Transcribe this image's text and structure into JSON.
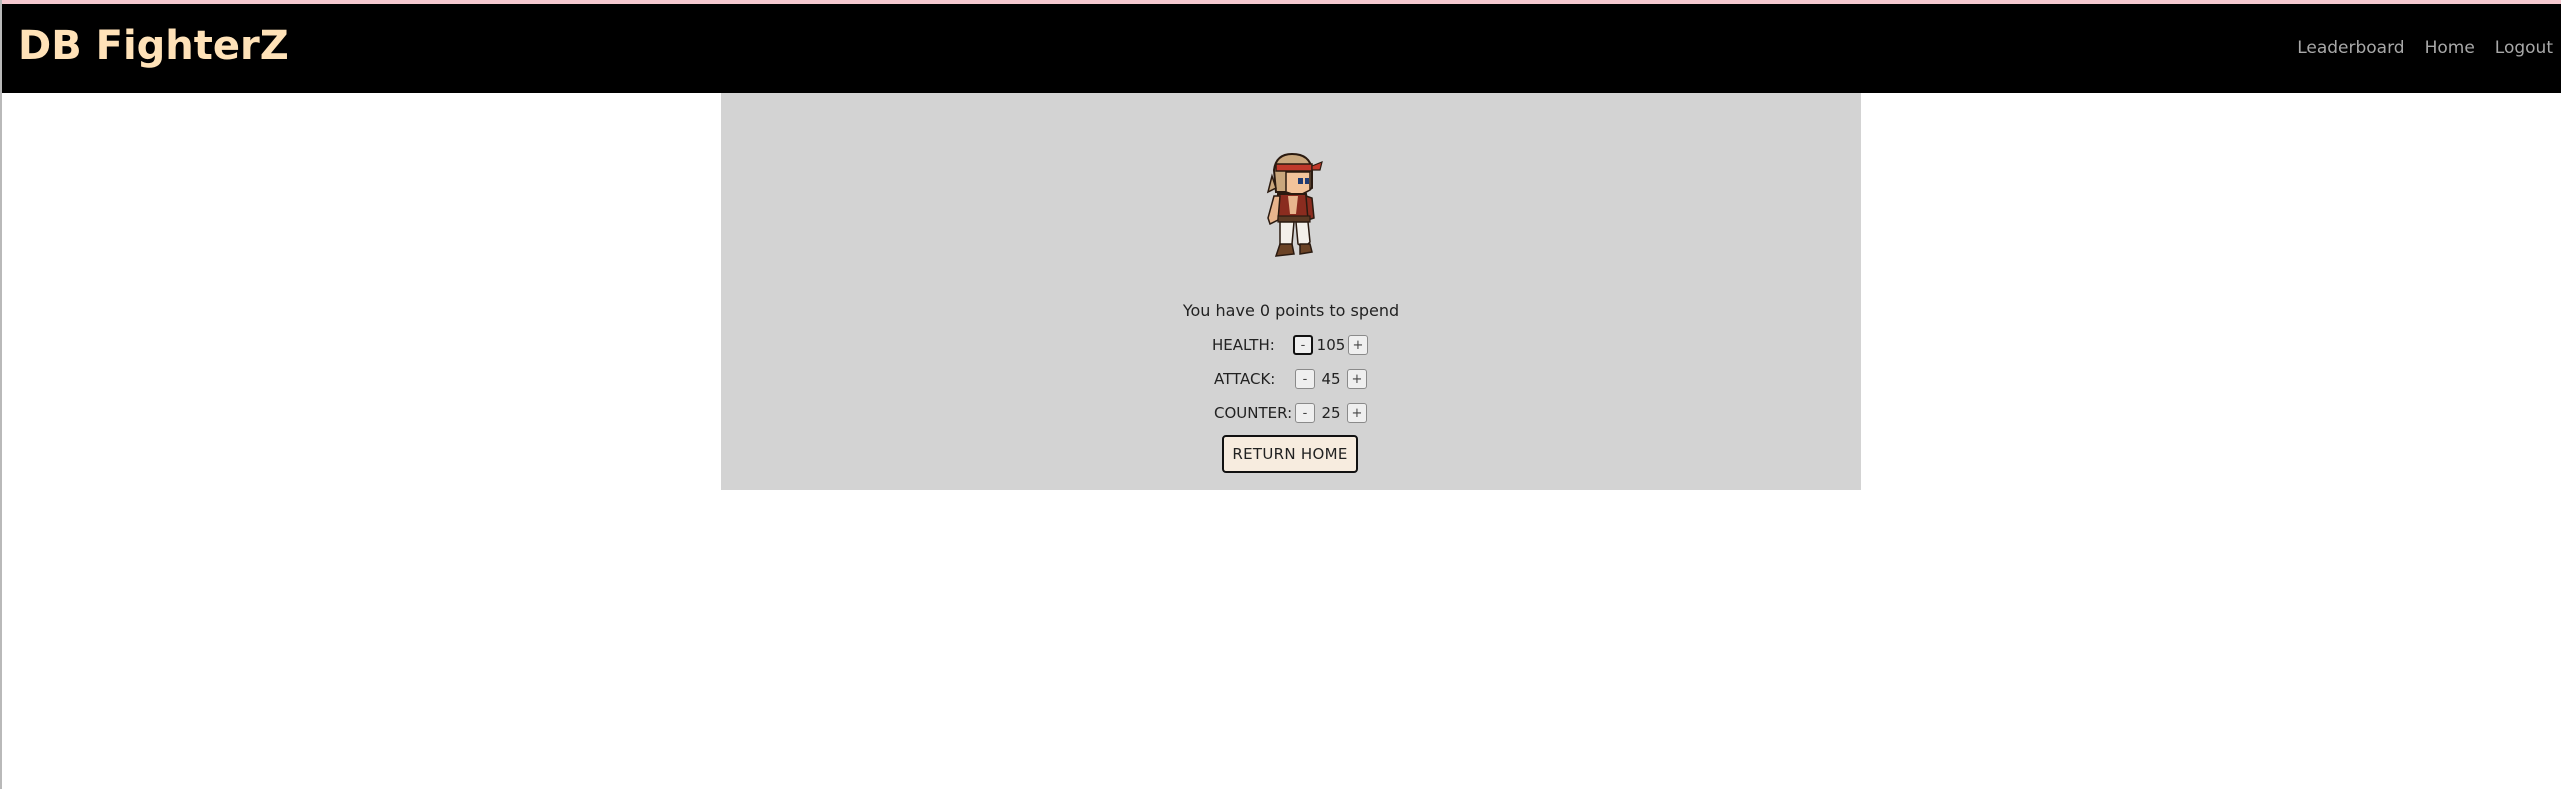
{
  "app": {
    "brand": "DB FighterZ"
  },
  "nav": {
    "links": [
      {
        "label": "Leaderboard"
      },
      {
        "label": "Home"
      },
      {
        "label": "Logout"
      }
    ]
  },
  "character": {
    "sprite": "fighter-sprite"
  },
  "upgrade": {
    "points_text": "You have 0 points to spend",
    "stats": [
      {
        "label": "HEALTH:",
        "value": "105",
        "minus": "-",
        "plus": "+"
      },
      {
        "label": "ATTACK:",
        "value": "45",
        "minus": "-",
        "plus": "+"
      },
      {
        "label": "COUNTER:",
        "value": "25",
        "minus": "-",
        "plus": "+"
      }
    ],
    "return_label": "RETURN HOME"
  },
  "colors": {
    "navbar": "#000000",
    "brand": "#ffe2b8",
    "panel": "#d3d3d3",
    "return_button": "#f7ecdf"
  }
}
